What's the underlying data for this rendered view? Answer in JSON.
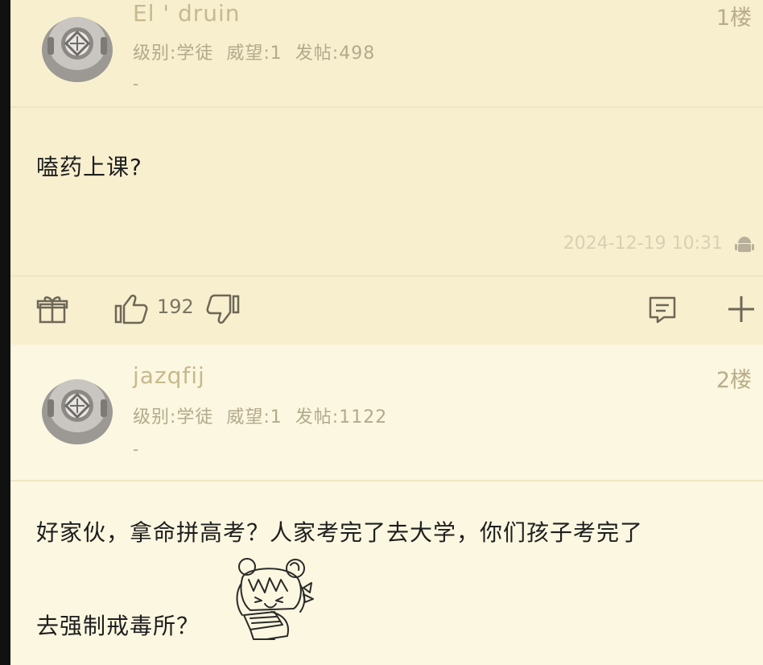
{
  "posts": [
    {
      "username": "El ' druin",
      "floor": "1楼",
      "meta": "级别:学徒  威望:1  发帖:498",
      "dash": "-",
      "content": "嗑药上课?",
      "time": "2024-12-19 10:31",
      "device_icon": "android-icon",
      "actions": {
        "gift_icon": "gift-icon",
        "like_icon": "thumbs-up-icon",
        "like_count": "192",
        "dislike_icon": "thumbs-down-icon",
        "comment_icon": "comment-icon",
        "add_icon": "plus-icon"
      }
    },
    {
      "username": "jazqfij",
      "floor": "2楼",
      "meta": "级别:学徒  威望:1  发帖:1122",
      "dash": "-",
      "content_line1": "好家伙，拿命拼高考？人家考完了去大学，你们孩子考完了",
      "content_line2": "去强制戒毒所？",
      "sticker": "anime-girl-sticker"
    }
  ]
}
